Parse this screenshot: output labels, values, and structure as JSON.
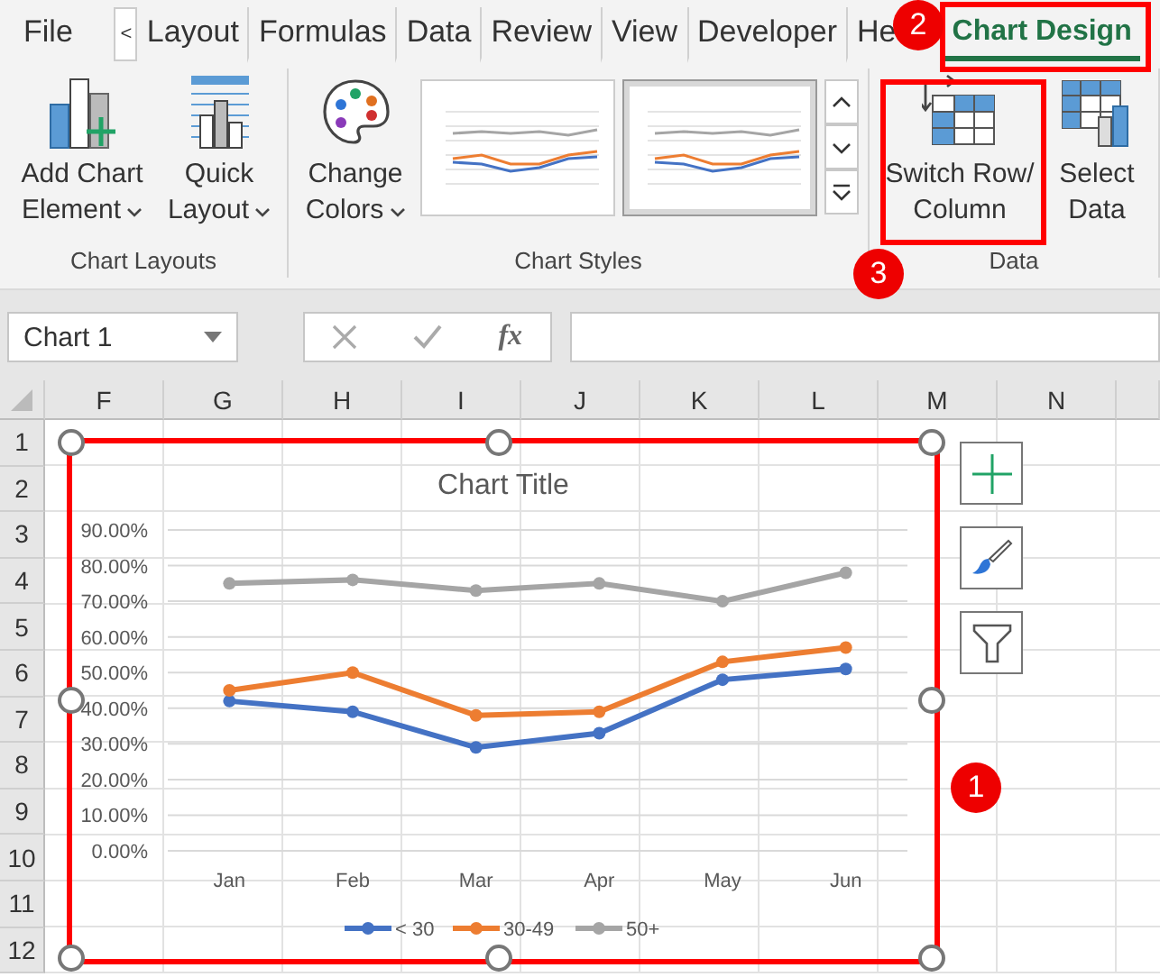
{
  "ribbon": {
    "scroll_button": "<",
    "tabs": [
      {
        "label": "File",
        "selected": false
      },
      {
        "label": "Layout",
        "selected": false
      },
      {
        "label": "Formulas",
        "selected": false
      },
      {
        "label": "Data",
        "selected": false
      },
      {
        "label": "Review",
        "selected": false
      },
      {
        "label": "View",
        "selected": false
      },
      {
        "label": "Developer",
        "selected": false
      },
      {
        "label": "He",
        "selected": false
      },
      {
        "label": "Chart Design",
        "selected": true
      }
    ]
  },
  "groups": [
    {
      "label": "Chart Layouts",
      "buttons": [
        {
          "kind": "add-element",
          "label": "Add Chart Element",
          "dropdown": true
        },
        {
          "kind": "quick-layout",
          "label": "Quick Layout",
          "dropdown": true
        }
      ]
    },
    {
      "label": "Chart Styles",
      "buttons": [
        {
          "kind": "colors",
          "label": "Change Colors",
          "dropdown": true
        }
      ],
      "gallery": [
        {
          "selected": false
        },
        {
          "selected": true
        }
      ]
    },
    {
      "label": "Data",
      "buttons": [
        {
          "kind": "switch",
          "label": "Switch Row/ Column",
          "dropdown": false
        },
        {
          "kind": "select",
          "label": "Select Data",
          "dropdown": false
        }
      ]
    }
  ],
  "formula_bar": {
    "name_box": "Chart 1",
    "function_label": "fx"
  },
  "sheet": {
    "columns": [
      "F",
      "G",
      "H",
      "I",
      "J",
      "K",
      "L",
      "M",
      "N"
    ],
    "rows": [
      "1",
      "2",
      "3",
      "4",
      "5",
      "6",
      "7",
      "8",
      "9",
      "10",
      "11",
      "12"
    ]
  },
  "chart": {
    "title": "Chart Title",
    "chart_data": {
      "type": "line",
      "grid": true,
      "legend": true,
      "categories": [
        "Jan",
        "Feb",
        "Mar",
        "Apr",
        "May",
        "Jun"
      ],
      "series": [
        {
          "name": "< 30",
          "color": "#4472c4",
          "marker": "circle",
          "values": [
            0.42,
            0.39,
            0.29,
            0.33,
            0.48,
            0.51
          ]
        },
        {
          "name": "30-49",
          "color": "#ed7d31",
          "marker": "circle",
          "values": [
            0.45,
            0.5,
            0.38,
            0.39,
            0.53,
            0.57
          ]
        },
        {
          "name": "50+",
          "color": "#a5a5a5",
          "marker": "circle",
          "values": [
            0.75,
            0.76,
            0.73,
            0.75,
            0.7,
            0.78
          ]
        }
      ],
      "ylim": [
        0,
        0.9
      ],
      "yticks": [
        {
          "value": 0,
          "label": "0.00%"
        },
        {
          "value": 0.1,
          "label": "10.00%"
        },
        {
          "value": 0.2,
          "label": "20.00%"
        },
        {
          "value": 0.3,
          "label": "30.00%"
        },
        {
          "value": 0.4,
          "label": "40.00%"
        },
        {
          "value": 0.5,
          "label": "50.00%"
        },
        {
          "value": 0.6,
          "label": "60.00%"
        },
        {
          "value": 0.7,
          "label": "70.00%"
        },
        {
          "value": 0.8,
          "label": "80.00%"
        },
        {
          "value": 0.9,
          "label": "90.00%"
        }
      ]
    }
  },
  "annotations": [
    {
      "label": "1"
    },
    {
      "label": "2"
    },
    {
      "label": "3"
    }
  ]
}
